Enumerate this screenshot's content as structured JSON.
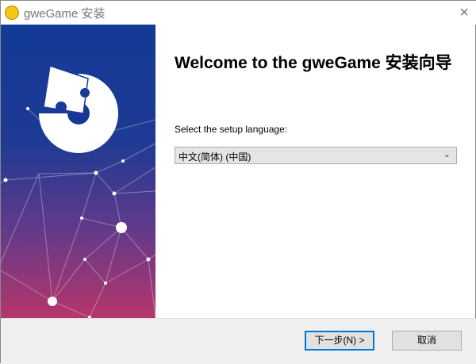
{
  "window": {
    "title": "gweGame 安装",
    "close_icon": "×"
  },
  "main": {
    "heading": "Welcome to the gweGame 安装向导",
    "language_label": "Select the setup language:",
    "language_selected": "中文(简体) (中国)"
  },
  "footer": {
    "next_label": "下一步(N) >",
    "cancel_label": "取消"
  },
  "colors": {
    "accent": "#0078d7",
    "footer_bg": "#f0f0f0"
  }
}
